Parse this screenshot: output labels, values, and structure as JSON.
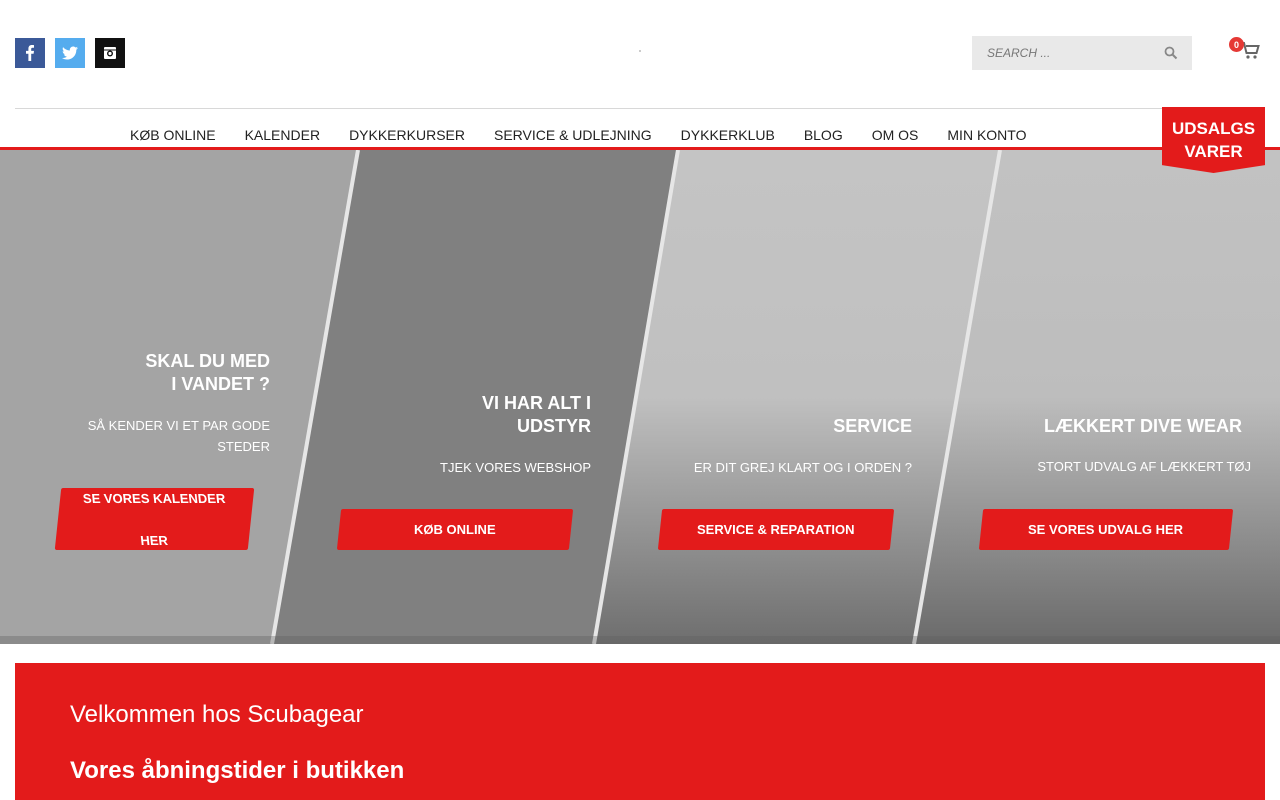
{
  "social": {
    "facebook": "facebook-icon",
    "twitter": "twitter-icon",
    "instagram": "instagram-icon"
  },
  "search": {
    "placeholder": "SEARCH ..."
  },
  "cart": {
    "count": "0"
  },
  "nav": {
    "items": [
      {
        "label": "KØB ONLINE"
      },
      {
        "label": "KALENDER"
      },
      {
        "label": "DYKKERKURSER"
      },
      {
        "label": "SERVICE & UDLEJNING"
      },
      {
        "label": "DYKKERKLUB"
      },
      {
        "label": "BLOG"
      },
      {
        "label": "OM OS"
      },
      {
        "label": "MIN KONTO"
      }
    ]
  },
  "sale_badge": {
    "line1": "UDSALGS",
    "line2": "VARER"
  },
  "hero": {
    "panels": [
      {
        "title_l1": "SKAL DU MED",
        "title_l2": "I VANDET ?",
        "text_l1": "SÅ KENDER VI ET PAR GODE",
        "text_l2": "STEDER",
        "button_l1": "SE VORES KALENDER",
        "button_l2": "HER"
      },
      {
        "title_l1": "VI HAR ALT I",
        "title_l2": "UDSTYR",
        "text": "TJEK VORES WEBSHOP",
        "button": "KØB ONLINE"
      },
      {
        "title": "SERVICE",
        "text": "ER DIT GREJ KLART OG I ORDEN ?",
        "button": "SERVICE & REPARATION"
      },
      {
        "title": "LÆKKERT DIVE WEAR",
        "text": "STORT UDVALG AF LÆKKERT TØJ",
        "button": "SE VORES UDVALG HER"
      }
    ]
  },
  "welcome": {
    "title": "Velkommen hos Scubagear",
    "subtitle": "Vores åbningstider i butikken"
  },
  "colors": {
    "accent": "#e31b1b",
    "facebook": "#3b5998",
    "twitter": "#55acee"
  }
}
